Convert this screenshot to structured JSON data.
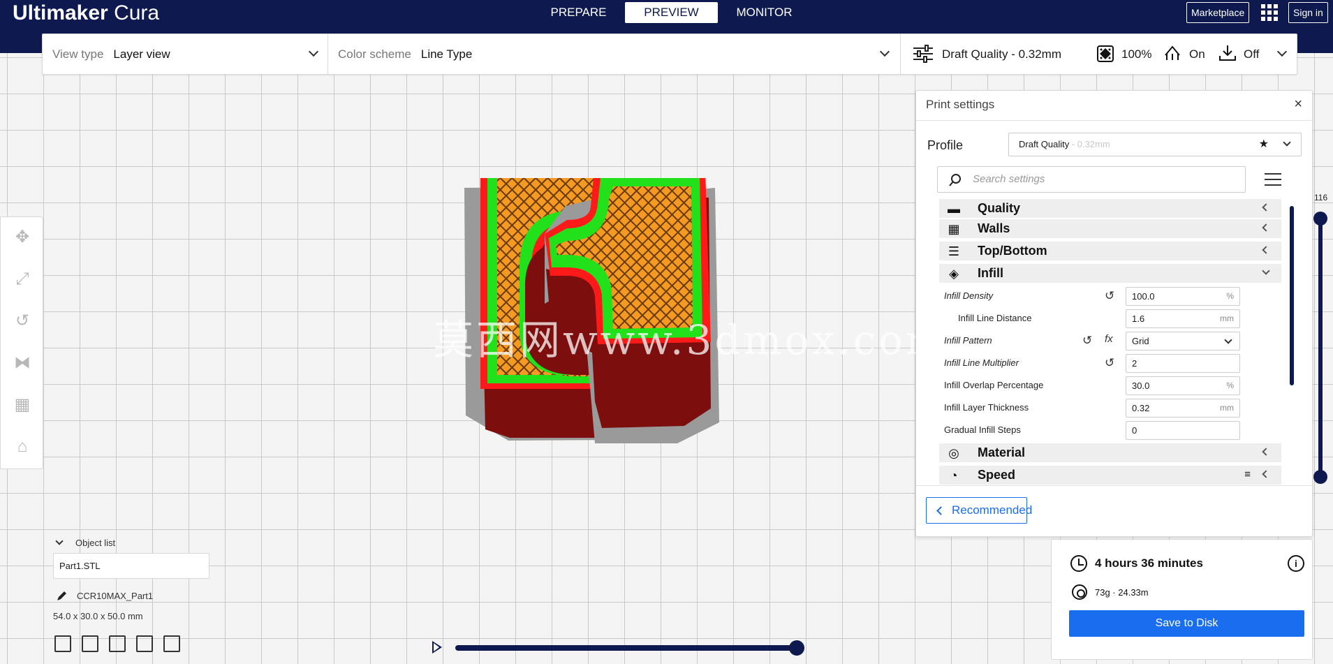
{
  "app": {
    "logo_bold": "Ultimaker",
    "logo_light": "Cura"
  },
  "header": {
    "tabs": [
      "PREPARE",
      "PREVIEW",
      "MONITOR"
    ],
    "active_tab": "PREVIEW",
    "marketplace": "Marketplace",
    "sign_in": "Sign in",
    "apps_icon": "apps-grid-icon"
  },
  "toolbar": {
    "view_type_label": "View type",
    "view_type_value": "Layer view",
    "color_scheme_label": "Color scheme",
    "color_scheme_value": "Line Type",
    "quality": "Draft Quality - 0.32mm",
    "infill": "100%",
    "support": "On",
    "adhesion": "Off"
  },
  "watermark": "莫西网www.3dmox.com",
  "print_settings": {
    "title": "Print settings",
    "profile_label": "Profile",
    "profile_value": "Draft Quality",
    "profile_sub": " - 0.32mm",
    "search_placeholder": "Search settings",
    "categories": [
      {
        "label": "Quality",
        "icon": "quality-icon",
        "expanded": false
      },
      {
        "label": "Walls",
        "icon": "walls-icon",
        "expanded": false
      },
      {
        "label": "Top/Bottom",
        "icon": "top-bottom-icon",
        "expanded": false
      },
      {
        "label": "Infill",
        "icon": "infill-icon",
        "expanded": true
      },
      {
        "label": "Material",
        "icon": "material-icon",
        "expanded": false
      },
      {
        "label": "Speed",
        "icon": "speed-icon",
        "expanded": false
      }
    ],
    "infill_settings": [
      {
        "label": "Infill Density",
        "value": "100.0",
        "unit": "%",
        "italic": true,
        "reset": true,
        "fx": false
      },
      {
        "label": "Infill Line Distance",
        "value": "1.6",
        "unit": "mm",
        "italic": false,
        "reset": false,
        "fx": false
      },
      {
        "label": "Infill Pattern",
        "value": "Grid",
        "unit": "",
        "italic": true,
        "reset": true,
        "fx": true
      },
      {
        "label": "Infill Line Multiplier",
        "value": "2",
        "unit": "",
        "italic": true,
        "reset": true,
        "fx": false
      },
      {
        "label": "Infill Overlap Percentage",
        "value": "30.0",
        "unit": "%",
        "italic": false,
        "reset": false,
        "fx": false
      },
      {
        "label": "Infill Layer Thickness",
        "value": "0.32",
        "unit": "mm",
        "italic": false,
        "reset": false,
        "fx": false
      },
      {
        "label": "Gradual Infill Steps",
        "value": "0",
        "unit": "",
        "italic": false,
        "reset": false,
        "fx": false
      }
    ],
    "recommended_button": "Recommended"
  },
  "layer_slider": {
    "current_layer": "116"
  },
  "object_list": {
    "header": "Object list",
    "items": [
      "Part1.STL"
    ],
    "job_name": "CCR10MAX_Part1",
    "dimensions": "54.0 x 30.0 x 50.0 mm"
  },
  "print_info": {
    "time": "4 hours 36 minutes",
    "material": "73g · 24.33m",
    "save_button": "Save to Disk"
  },
  "colors": {
    "header_bg": "#0e1a4f",
    "accent_blue": "#196ef0",
    "wall_outer": "#ff1a1a",
    "wall_inner": "#22e01a",
    "infill": "#f49a23",
    "model_side": "#7c0e0e",
    "shadow": "#9a9a9a"
  }
}
